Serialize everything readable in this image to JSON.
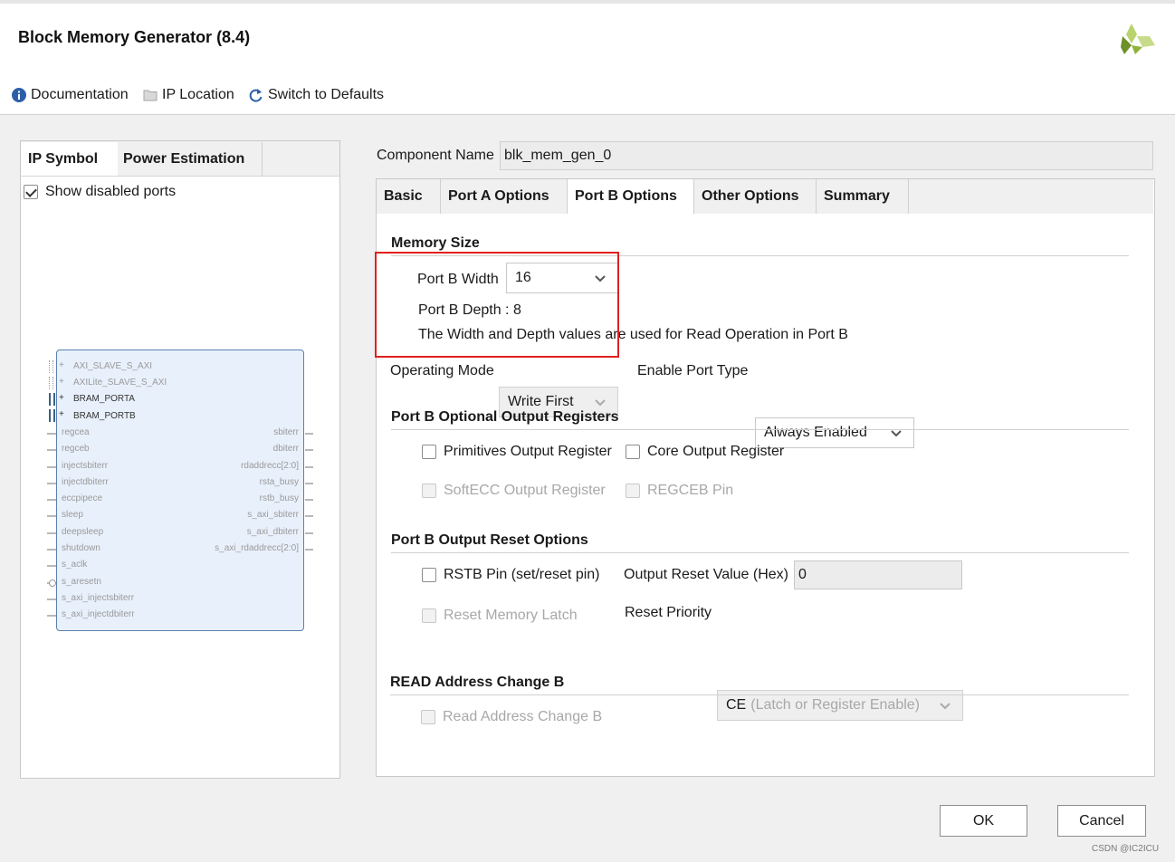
{
  "window": {
    "title": "Block Memory Generator (8.4)"
  },
  "toolbar": {
    "documentation": "Documentation",
    "ip_location": "IP Location",
    "switch_defaults": "Switch to Defaults"
  },
  "left": {
    "tabs": [
      "IP Symbol",
      "Power Estimation"
    ],
    "show_disabled_ports": "Show disabled ports",
    "show_disabled_checked": true,
    "bus_pins": [
      "AXI_SLAVE_S_AXI",
      "AXILite_SLAVE_S_AXI",
      "BRAM_PORTA",
      "BRAM_PORTB"
    ],
    "left_pins": [
      "regcea",
      "regceb",
      "injectsbiterr",
      "injectdbiterr",
      "eccpipece",
      "sleep",
      "deepsleep",
      "shutdown",
      "s_aclk",
      "s_aresetn",
      "s_axi_injectsbiterr",
      "s_axi_injectdbiterr"
    ],
    "right_pins": [
      "sbiterr",
      "dbiterr",
      "rdaddrecc[2:0]",
      "rsta_busy",
      "rstb_busy",
      "s_axi_sbiterr",
      "s_axi_dbiterr",
      "s_axi_rdaddrecc[2:0]"
    ]
  },
  "component": {
    "label": "Component Name",
    "value": "blk_mem_gen_0"
  },
  "tabs": [
    "Basic",
    "Port A Options",
    "Port B Options",
    "Other Options",
    "Summary"
  ],
  "active_tab": "Port B Options",
  "memory_size": {
    "title": "Memory Size",
    "width_label": "Port B Width",
    "width_value": "16",
    "depth_text": "Port B Depth : 8",
    "note": "The Width and Depth values are used for Read Operation in Port B"
  },
  "operating": {
    "mode_label": "Operating Mode",
    "mode_value": "Write First",
    "enable_label": "Enable Port Type",
    "enable_value": "Always Enabled"
  },
  "output_registers": {
    "title": "Port B Optional Output Registers",
    "primitives": "Primitives Output Register",
    "core": "Core Output Register",
    "softecc": "SoftECC Output Register",
    "regceb": "REGCEB Pin"
  },
  "reset_options": {
    "title": "Port B Output Reset Options",
    "rstb": "RSTB Pin (set/reset pin)",
    "reset_value_label": "Output Reset Value (Hex)",
    "reset_value": "0",
    "reset_latch": "Reset Memory Latch",
    "priority_label": "Reset Priority",
    "priority_value_main": "CE",
    "priority_value_note": "(Latch or Register Enable)"
  },
  "read_address": {
    "title": "READ Address Change B",
    "checkbox": "Read Address Change B"
  },
  "buttons": {
    "ok": "OK",
    "cancel": "Cancel"
  },
  "watermark": "CSDN @IC2ICU",
  "colors": {
    "highlight_box": "#e02020",
    "symbol_fill": "#e8f0fb",
    "logo_green": "#8fb339"
  },
  "icons": [
    "info-icon",
    "folder-icon",
    "refresh-icon",
    "chevron-down-icon",
    "plus-icon",
    "logo-icon"
  ]
}
